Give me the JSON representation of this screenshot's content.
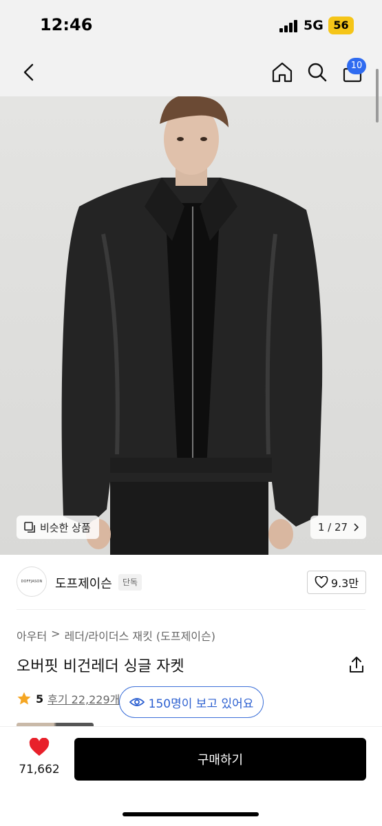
{
  "status": {
    "time": "12:46",
    "network": "5G",
    "battery": "56"
  },
  "nav": {
    "cart_count": "10"
  },
  "hero": {
    "similar_label": "비슷한 상품",
    "counter": "1 / 27"
  },
  "brand": {
    "logo_text": "DOFFJASON",
    "name": "도프제이슨",
    "tag": "단독",
    "likes": "9.3만"
  },
  "breadcrumb": {
    "category": "아우터",
    "sep": ">",
    "subcategory": "레더/라이더스 재킷 (도프제이슨)"
  },
  "product": {
    "title": "오버핏 비건레더 싱글 자켓"
  },
  "rating": {
    "score": "5",
    "reviews": "후기 22,229개"
  },
  "viewing": {
    "label": "150명이 보고 있어요"
  },
  "bottom": {
    "like_count": "71,662",
    "buy_label": "구매하기"
  },
  "colors": {
    "accent": "#2f6bf0",
    "heart": "#e8202a",
    "buy": "#000000",
    "star": "#f5a623"
  }
}
